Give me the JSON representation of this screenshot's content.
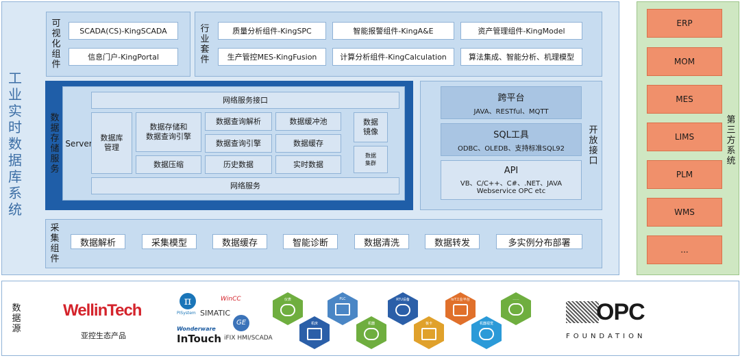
{
  "system_title": [
    "工",
    "业",
    "实",
    "时",
    "数",
    "据",
    "库",
    "系",
    "统"
  ],
  "visual": {
    "label": [
      "可",
      "视",
      "化",
      "组",
      "件"
    ],
    "items": [
      "SCADA(CS)-KingSCADA",
      "信息门户-KingPortal"
    ]
  },
  "industry": {
    "label": [
      "行",
      "业",
      "套",
      "件"
    ],
    "items": [
      "质量分析组件-KingSPC",
      "智能报警组件-KingA&E",
      "资产管理组件-KingModel",
      "生产管控MES-KingFusion",
      "计算分析组件-KingCalculation",
      "算法集成、智能分析、机理模型"
    ]
  },
  "storage": {
    "label": [
      "数",
      "据",
      "存",
      "储",
      "服",
      "务"
    ],
    "server": "Server",
    "network_interface": "网络服务接口",
    "db_mgmt": "数据库\n管理",
    "storage_engine": "数据存储和\n数据查询引擎",
    "query_parse": "数据查询解析",
    "cache_pool": "数据缓冲池",
    "query_engine": "数据查询引擎",
    "data_cache": "数据缓存",
    "compress": "数据压缩",
    "history": "历史数据",
    "realtime": "实时数据",
    "mirror": "数据\n镜像",
    "cluster": "数据\n集群",
    "network_service": "网络服务"
  },
  "open": {
    "label": [
      "开",
      "放",
      "接",
      "口"
    ],
    "cross_title": "跨平台",
    "cross_sub": "JAVA、RESTful、MQTT",
    "sql_title": "SQL工具",
    "sql_sub": "ODBC、OLEDB、支持标准SQL92",
    "api_title": "API",
    "api_sub1": "VB、C/C++、C#、.NET、JAVA",
    "api_sub2": "Webservice  OPC etc"
  },
  "collect": {
    "label": [
      "采",
      "集",
      "组",
      "件"
    ],
    "items": [
      "数据解析",
      "采集模型",
      "数据缓存",
      "智能诊断",
      "数据清洗",
      "数据转发",
      "多实例分布部署"
    ]
  },
  "third_party": {
    "label": [
      "第",
      "三",
      "方",
      "系",
      "统"
    ],
    "items": [
      "ERP",
      "MOM",
      "MES",
      "LIMS",
      "PLM",
      "WMS",
      "..."
    ]
  },
  "source": {
    "label": [
      "数",
      "据",
      "源"
    ],
    "wellintech": "WellinTech",
    "wellintech_sub": "亚控生态产品",
    "pisystem": "PISystem",
    "simatic": "SIMATIC",
    "wincc": "WinCC",
    "wonderware": "Wonderware",
    "intouch": "InTouch",
    "ifix": "iFIX HMI/SCADA",
    "ge": "GE",
    "opc": "OPC",
    "opc_foundation": "FOUNDATION",
    "hexes": [
      {
        "label": "仪表",
        "color": "#6fae3f",
        "icon": "gauge-icon"
      },
      {
        "label": "PLC",
        "color": "#4a86c5",
        "icon": "plc-icon"
      },
      {
        "label": "RTU设备",
        "color": "#2b5fa8",
        "icon": "rtu-icon"
      },
      {
        "label": "IoT工业平台",
        "color": "#e0702b",
        "icon": "iot-icon"
      },
      {
        "label": "......",
        "color": "#6fae3f",
        "icon": "5g-icon"
      },
      {
        "label": "机床",
        "color": "#2b5fa8",
        "icon": "machine-icon"
      },
      {
        "label": "机器",
        "color": "#6fae3f",
        "icon": "robot-icon"
      },
      {
        "label": "板卡",
        "color": "#e0a12b",
        "icon": "board-icon"
      },
      {
        "label": "机器视觉",
        "color": "#2b9ad8",
        "icon": "camera-icon"
      }
    ]
  },
  "colors": {
    "panel": "#c7dcf0",
    "storage_dark": "#1f5ea8",
    "third_party_bg": "#cfe7c2",
    "third_party_item": "#f0906b"
  }
}
